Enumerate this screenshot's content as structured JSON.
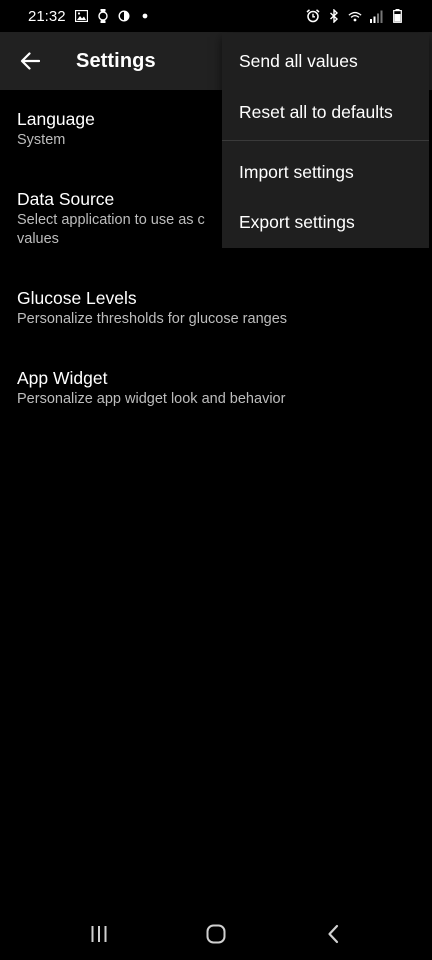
{
  "status_bar": {
    "time": "21:32",
    "left_icons": [
      "gallery-icon",
      "watch-icon",
      "data-saver-icon",
      "dot-icon"
    ],
    "right_icons": [
      "alarm-icon",
      "bluetooth-icon",
      "wifi-icon",
      "signal-icon",
      "battery-icon"
    ]
  },
  "app_bar": {
    "title": "Settings",
    "back_icon": "arrow-left-icon"
  },
  "settings": [
    {
      "title": "Language",
      "summary": "System"
    },
    {
      "title": "Data Source",
      "summary_line1": "Select application to use as c",
      "summary_line2": "values"
    },
    {
      "title": "Glucose Levels",
      "summary": "Personalize thresholds for glucose ranges"
    },
    {
      "title": "App Widget",
      "summary": "Personalize app widget look and behavior"
    }
  ],
  "menu": {
    "items": [
      "Send all values",
      "Reset all to defaults",
      "Import settings",
      "Export settings"
    ]
  },
  "nav_bar": {
    "icons": [
      "recent-apps-icon",
      "home-icon",
      "back-icon"
    ]
  },
  "colors": {
    "background": "#000000",
    "app_bar": "#212121",
    "menu": "#1f1f1f",
    "summary_text": "#bdbdbd"
  }
}
